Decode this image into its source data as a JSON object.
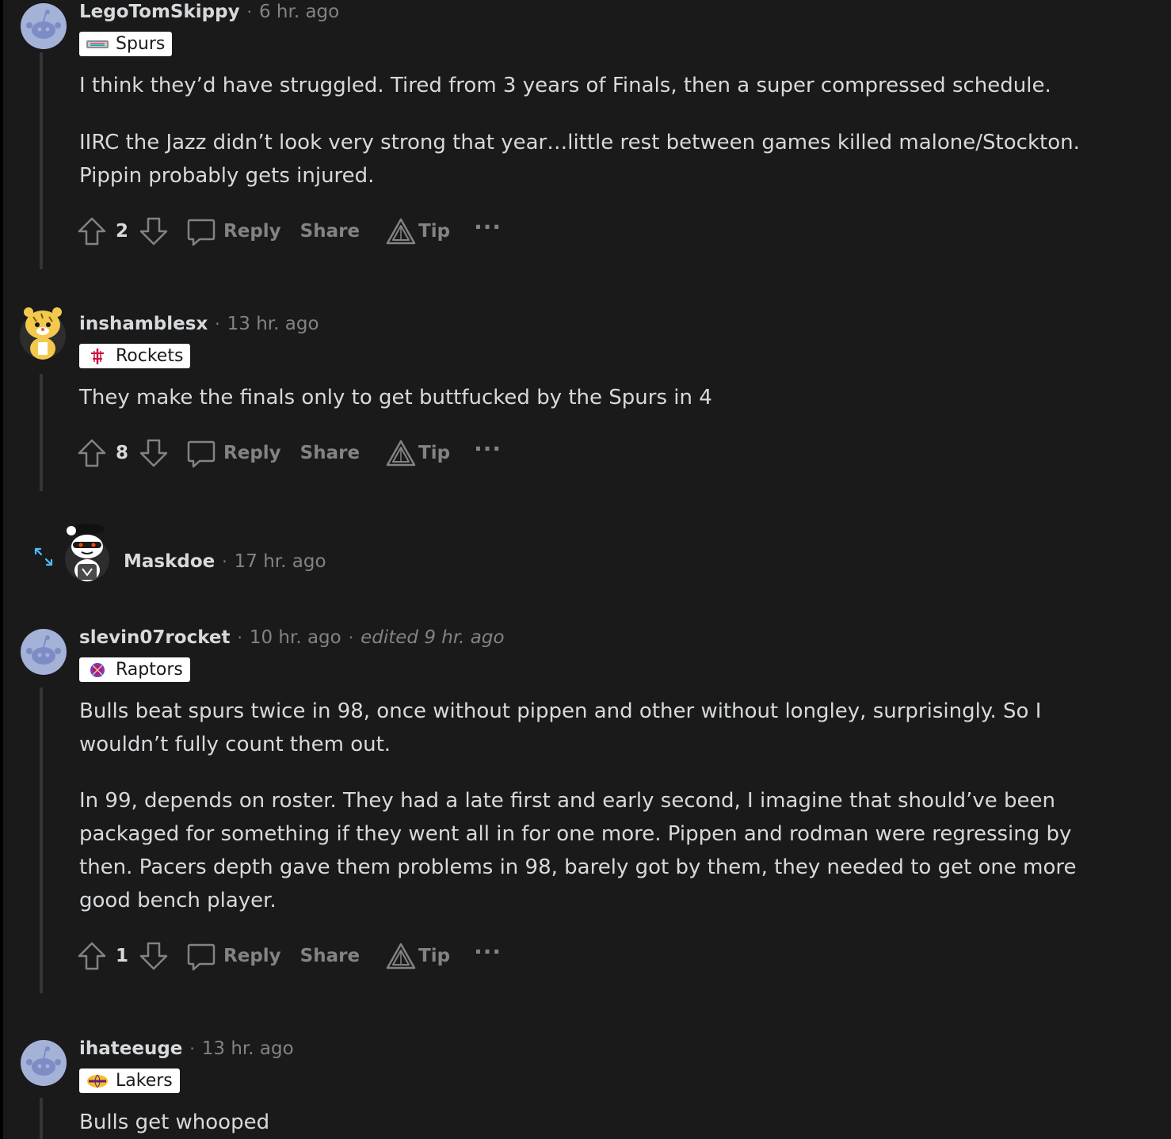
{
  "colors": {
    "page_background": "#1a1a1b",
    "text_primary": "#d7dadc",
    "text_muted": "#818384",
    "thread_line": "#343536",
    "flair_background": "#ffffff",
    "expand_icon": "#4fbcff",
    "default_avatar": "#a5b2d8"
  },
  "comments": [
    {
      "author": "LegoTomSkippy",
      "time": "6 hr. ago",
      "flair": "Spurs",
      "avatar_icon": "snoo-default-avatar-icon",
      "body": [
        "I think they’d have struggled. Tired from 3 years of Finals, then a super compressed schedule.",
        "IIRC the Jazz didn’t look very strong that year…little rest between games killed malone/Stockton. Pippin probably gets injured."
      ],
      "score": "2",
      "reply_label": "Reply",
      "share_label": "Share",
      "tip_label": "Tip",
      "more_label": "···"
    },
    {
      "author": "inshamblesx",
      "time": "13 hr. ago",
      "flair": "Rockets",
      "avatar_icon": "snoo-tiger-avatar-icon",
      "body": [
        "They make the finals only to get buttfucked by the Spurs in 4"
      ],
      "score": "8",
      "reply_label": "Reply",
      "share_label": "Share",
      "tip_label": "Tip",
      "more_label": "···"
    },
    {
      "author": "Maskdoe",
      "time": "17 hr. ago",
      "collapsed": true,
      "avatar_icon": "snoo-masked-avatar-icon"
    },
    {
      "author": "slevin07rocket",
      "time": "10 hr. ago",
      "edited": "edited 9 hr. ago",
      "flair": "Raptors",
      "avatar_icon": "snoo-default-avatar-icon",
      "body": [
        "Bulls beat spurs twice in 98, once without pippen and other without longley, surprisingly. So I wouldn’t fully count them out.",
        "In 99, depends on roster. They had a late first and early second, I imagine that should’ve been packaged for something if they went all in for one more. Pippen and rodman were regressing by then. Pacers depth gave them problems in 98, barely got by them, they needed to get one more good bench player."
      ],
      "score": "1",
      "reply_label": "Reply",
      "share_label": "Share",
      "tip_label": "Tip",
      "more_label": "···"
    },
    {
      "author": "ihateeuge",
      "time": "13 hr. ago",
      "flair": "Lakers",
      "avatar_icon": "snoo-default-avatar-icon",
      "body": [
        "Bulls get whooped"
      ]
    }
  ]
}
